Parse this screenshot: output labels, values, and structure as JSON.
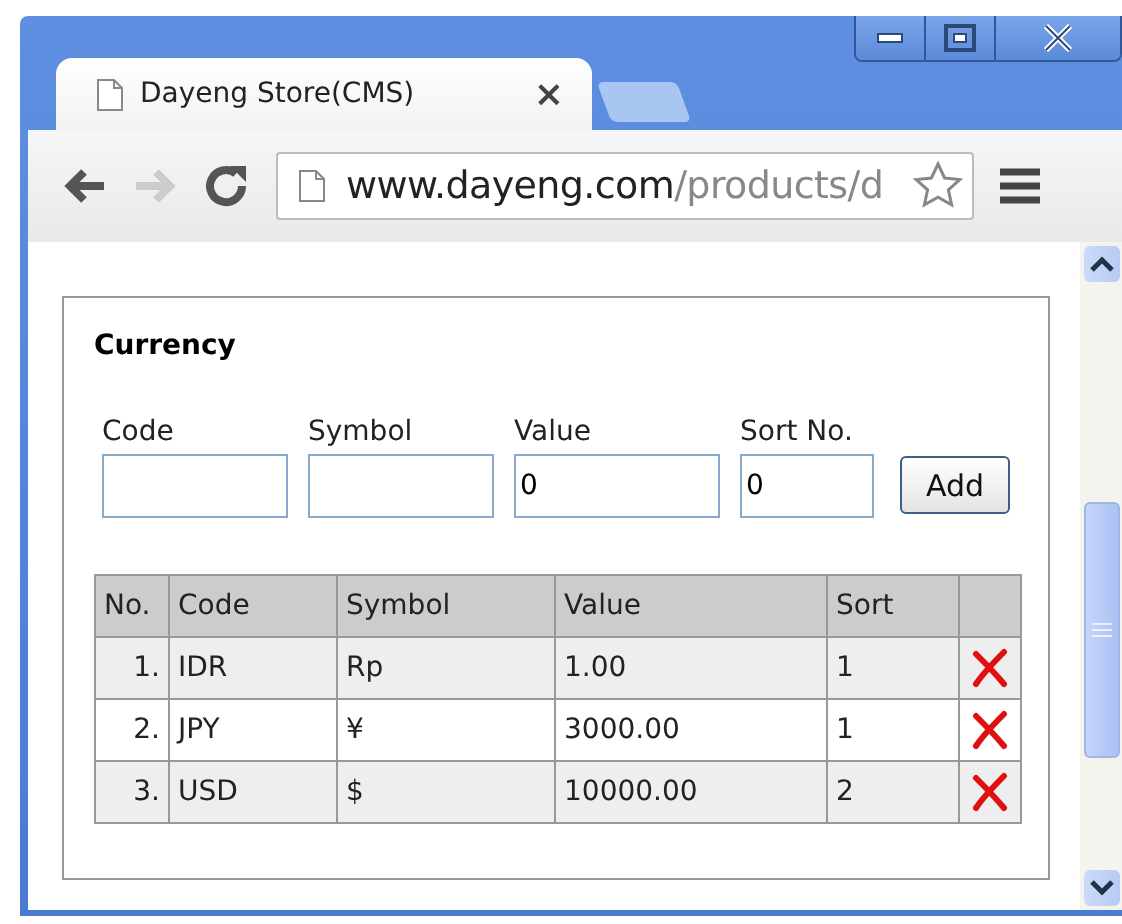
{
  "browser": {
    "tab": {
      "title": "Dayeng Store(CMS)",
      "close": "×"
    },
    "address": {
      "host": "www.dayeng.com",
      "path": "/products/d"
    }
  },
  "panel": {
    "title": "Currency",
    "fields": [
      {
        "label": "Code"
      },
      {
        "label": "Symbol"
      },
      {
        "label": "Value",
        "value": "0"
      },
      {
        "label": "Sort No.",
        "value": "0"
      }
    ],
    "button": "Add",
    "table": {
      "columns": [
        "No.",
        "Code",
        "Symbol",
        "Value",
        "Sort"
      ],
      "rows": [
        {
          "no": "1.",
          "code": "IDR",
          "symbol": "Rp",
          "value": "1.00",
          "sort": "1"
        },
        {
          "no": "2.",
          "code": "JPY",
          "symbol": "¥",
          "value": "3000.00",
          "sort": "1"
        },
        {
          "no": "3.",
          "code": "USD",
          "symbol": "$",
          "value": "10000.00",
          "sort": "2"
        }
      ]
    }
  }
}
